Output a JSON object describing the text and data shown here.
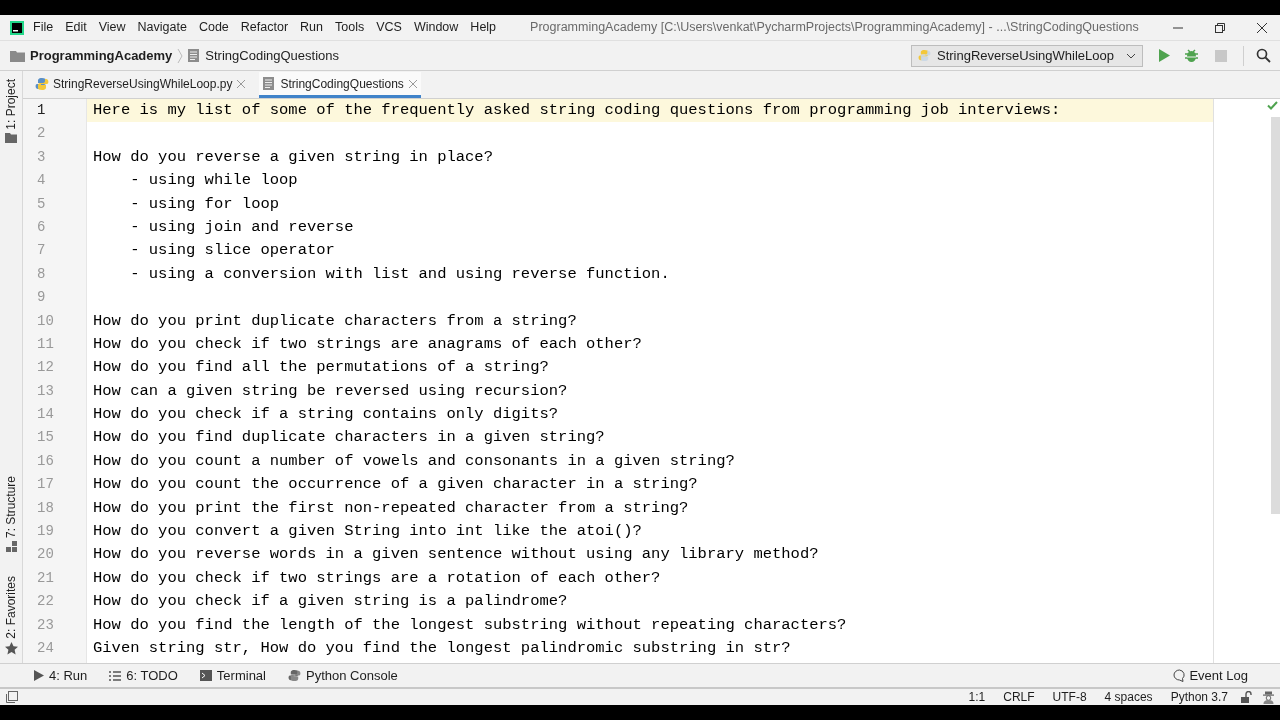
{
  "menu": [
    "File",
    "Edit",
    "View",
    "Navigate",
    "Code",
    "Refactor",
    "Run",
    "Tools",
    "VCS",
    "Window",
    "Help"
  ],
  "window": {
    "title": "ProgrammingAcademy [C:\\Users\\venkat\\PycharmProjects\\ProgrammingAcademy] - ...\\StringCodingQuestions"
  },
  "breadcrumb": [
    "ProgrammingAcademy",
    "StringCodingQuestions"
  ],
  "run_config": "StringReverseUsingWhileLoop",
  "tabs": [
    {
      "label": "StringReverseUsingWhileLoop.py",
      "kind": "python",
      "selected": false
    },
    {
      "label": "StringCodingQuestions",
      "kind": "text",
      "selected": true
    }
  ],
  "side_tools": [
    {
      "label": "1: Project",
      "kind": "project"
    },
    {
      "label": "7: Structure",
      "kind": "structure"
    },
    {
      "label": "2: Favorites",
      "kind": "favorites"
    }
  ],
  "lines": [
    {
      "number": "1",
      "text": "Here is my list of some of the frequently asked string coding questions from programming job interviews:",
      "current": true
    },
    {
      "number": "2",
      "current": false
    },
    {
      "number": "3",
      "text": "How do you reverse a given string in place?",
      "current": false
    },
    {
      "number": "4",
      "text": "    - using while loop",
      "current": false
    },
    {
      "number": "5",
      "text": "    - using for loop",
      "current": false
    },
    {
      "number": "6",
      "text": "    - using join and reverse",
      "current": false
    },
    {
      "number": "7",
      "text": "    - using slice operator",
      "current": false
    },
    {
      "number": "8",
      "text": "    - using a conversion with list and using reverse function.",
      "current": false
    },
    {
      "number": "9",
      "current": false
    },
    {
      "number": "10",
      "text": "How do you print duplicate characters from a string?",
      "current": false
    },
    {
      "number": "11",
      "text": "How do you check if two strings are anagrams of each other?",
      "current": false
    },
    {
      "number": "12",
      "text": "How do you find all the permutations of a string?",
      "current": false
    },
    {
      "number": "13",
      "text": "How can a given string be reversed using recursion?",
      "current": false
    },
    {
      "number": "14",
      "text": "How do you check if a string contains only digits?",
      "current": false
    },
    {
      "number": "15",
      "text": "How do you find duplicate characters in a given string?",
      "current": false
    },
    {
      "number": "16",
      "text": "How do you count a number of vowels and consonants in a given string?",
      "current": false
    },
    {
      "number": "17",
      "text": "How do you count the occurrence of a given character in a string?",
      "current": false
    },
    {
      "number": "18",
      "text": "How do you print the first non-repeated character from a string?",
      "current": false
    },
    {
      "number": "19",
      "text": "How do you convert a given String into int like the atoi()?",
      "current": false
    },
    {
      "number": "20",
      "text": "How do you reverse words in a given sentence without using any library method?",
      "current": false
    },
    {
      "number": "21",
      "text": "How do you check if two strings are a rotation of each other?",
      "current": false
    },
    {
      "number": "22",
      "text": "How do you check if a given string is a palindrome?",
      "current": false
    },
    {
      "number": "23",
      "text": "How do you find the length of the longest substring without repeating characters?",
      "current": false
    },
    {
      "number": "24",
      "text": "Given string str, How do you find the longest palindromic substring in str?",
      "current": false
    }
  ],
  "tool_buttons": [
    {
      "label": "4: Run",
      "kind": "run"
    },
    {
      "label": "6: TODO",
      "kind": "todo"
    },
    {
      "label": "Terminal",
      "kind": "terminal"
    },
    {
      "label": "Python Console",
      "kind": "python"
    }
  ],
  "event_log": "Event Log",
  "status_bar": [
    "1:1",
    "CRLF",
    "UTF-8",
    "4 spaces",
    "Python 3.7"
  ]
}
